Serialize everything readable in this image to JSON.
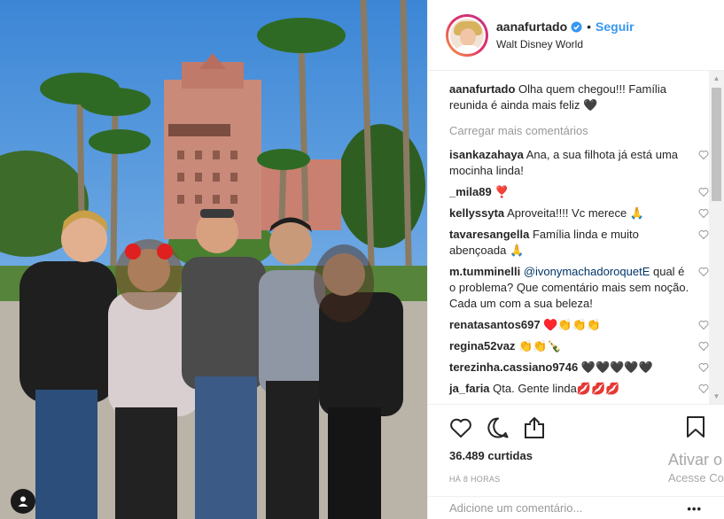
{
  "post": {
    "username": "aanafurtado",
    "location": "Walt Disney World",
    "follow_label": "Seguir",
    "separator": "•",
    "caption_user": "aanafurtado",
    "caption_text": " Olha quem chegou!!! Família reunida é ainda mais feliz 🖤",
    "load_more": "Carregar mais comentários",
    "likes_count": "36.489",
    "likes_label": " curtidas",
    "time": "HÁ 8 HORAS",
    "add_comment_placeholder": "Adicione um comentário...",
    "more_options": "•••"
  },
  "comments": [
    {
      "user": "isankazahaya",
      "text": " Ana, a sua filhota já está uma mocinha linda!"
    },
    {
      "user": "_mila89",
      "text": " ❣️"
    },
    {
      "user": "kellyssyta",
      "text": " Aproveita!!!! Vc merece 🙏"
    },
    {
      "user": "tavaresangella",
      "text": " Família linda e muito abençoada 🙏"
    },
    {
      "user": "m.tumminelli",
      "mention": "@ivonymachadoroquetE",
      "text": " qual é o problema? Que comentário mais sem noção. Cada um com a sua beleza!"
    },
    {
      "user": "renatasantos697",
      "text": " ♥️👏👏👏"
    },
    {
      "user": "regina52vaz",
      "text": " 👏👏🍾"
    },
    {
      "user": "terezinha.cassiano9746",
      "text": " 🖤🖤🖤🖤🖤"
    },
    {
      "user": "ja_faria",
      "text": " Qta. Gente linda💋💋💋"
    }
  ],
  "watermark": {
    "line1": "Ativar o",
    "line2": "Acesse Co"
  },
  "icons": {
    "like": "heart-icon",
    "comment": "comment-icon",
    "share": "share-icon",
    "save": "bookmark-icon",
    "verified": "verified-badge-icon",
    "user_tag": "user-tag-icon"
  },
  "colors": {
    "link_blue": "#3897f0",
    "text": "#262626",
    "muted": "#999999",
    "border": "#efefef"
  }
}
